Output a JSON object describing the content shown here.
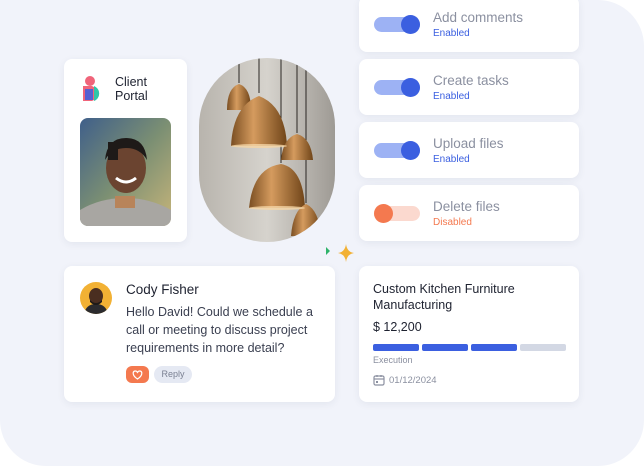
{
  "portal": {
    "title": "Client\nPortal"
  },
  "permissions": [
    {
      "label": "Add comments",
      "status": "Enabled",
      "enabled": true
    },
    {
      "label": "Create tasks",
      "status": "Enabled",
      "enabled": true
    },
    {
      "label": "Upload files",
      "status": "Enabled",
      "enabled": true
    },
    {
      "label": "Delete files",
      "status": "Disabled",
      "enabled": false
    }
  ],
  "message": {
    "sender": "Cody Fisher",
    "text": "Hello David! Could we schedule a call or meeting to discuss project requirements in more detail?",
    "reply_label": "Reply"
  },
  "project": {
    "title": "Custom Kitchen Furniture\nManufacturing",
    "amount": "$ 12,200",
    "stage": "Execution",
    "date": "01/12/2024",
    "progress_segments_done": 3,
    "progress_segments_total": 4
  },
  "colors": {
    "accent": "#3b5fe0",
    "accent_light": "#9db2f4",
    "warning": "#f4794f",
    "warning_light": "#fbd9cf",
    "background": "#f1f3fa"
  }
}
